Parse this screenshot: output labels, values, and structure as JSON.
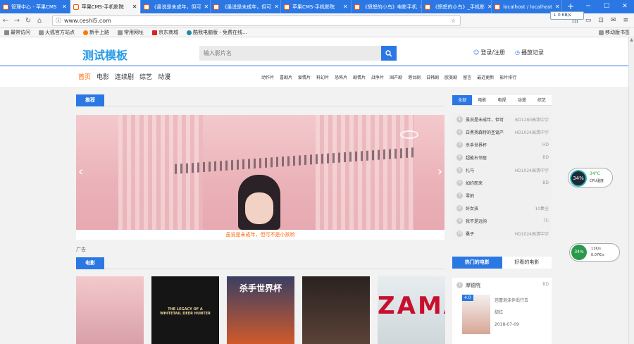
{
  "browser": {
    "tabs": [
      {
        "label": "管理中心 - 苹果CMS",
        "active": false
      },
      {
        "label": "苹果CMS-手机影院",
        "active": true
      },
      {
        "label": "《虽说是未成年，但可",
        "active": false
      },
      {
        "label": "《虽说是未成年，但可",
        "active": false
      },
      {
        "label": "苹果CMS-手机影院",
        "active": false
      },
      {
        "label": "《愤怒的小鸟》电影手机",
        "active": false
      },
      {
        "label": "《愤怒的小鸟》_手机影",
        "active": false
      },
      {
        "label": "localhost / localhost",
        "active": false
      }
    ],
    "url": "www.ceshi5.com",
    "net_badge": "↓ 0 KB/s",
    "bookmarks": [
      "最常访问",
      "火狐官方站点",
      "新手上路",
      "常用网址",
      "京东商城",
      "酷我电脑版 - 免费在线..."
    ],
    "mobile_bookmarks": "移动版书签"
  },
  "site": {
    "logo": "测试模板",
    "search_placeholder": "输入影片名",
    "login": "登录/注册",
    "history": "播放记录",
    "main_nav": [
      "首页",
      "电影",
      "连续剧",
      "综艺",
      "动漫"
    ],
    "cat_nav": [
      "动作片",
      "喜剧片",
      "爱情片",
      "科幻片",
      "恐怖片",
      "剧情片",
      "战争片",
      "国产剧",
      "港台剧",
      "日韩剧",
      "欧美剧",
      "留言",
      "最近更新",
      "影片排行"
    ],
    "recommend_title": "推荐",
    "slide_caption": "虽说是未成年，但可不是小孩哟",
    "ad_label": "广告",
    "movie_section_title": "电影",
    "rank_tabs": [
      "全部",
      "电影",
      "电视",
      "动漫",
      "综艺"
    ],
    "rank_list": [
      {
        "n": "1",
        "title": "虽说是未成年，但可",
        "tag": "BD1280高清中字"
      },
      {
        "n": "2",
        "title": "白黑扬森特的圣诞产",
        "tag": "HD1024高清中字"
      },
      {
        "n": "3",
        "title": "杀手世界杯",
        "tag": "HD"
      },
      {
        "n": "4",
        "title": "超能右邻居",
        "tag": "BD"
      },
      {
        "n": "5",
        "title": "扎马",
        "tag": "HD1024高清中字"
      },
      {
        "n": "6",
        "title": "如约而来",
        "tag": "BD"
      },
      {
        "n": "7",
        "title": "零拍",
        "tag": ""
      },
      {
        "n": "8",
        "title": "好女孩",
        "tag": "10集全"
      },
      {
        "n": "9",
        "title": "我不是远驹",
        "tag": "TC"
      },
      {
        "n": "10",
        "title": "桑子",
        "tag": "HD1024高清中字"
      }
    ],
    "hot_tabs": [
      "热门的电影",
      "好看的电影"
    ],
    "hot_first": {
      "n": "1",
      "title": "摩德院",
      "tag": "BD",
      "score": "4.0",
      "desc": "芭蕾泡沫伴侣行去",
      "extra": "甜红",
      "date": "2018-07-09"
    },
    "posters": [
      {
        "title": ""
      },
      {
        "title": "THE LEGACY OF A WHITETAIL DEER HUNTER"
      },
      {
        "title": "杀手世界杯"
      },
      {
        "title": ""
      },
      {
        "title": "ZAMA"
      }
    ]
  },
  "widgets": {
    "cpu_percent": "34%",
    "cpu_temp": "34°C",
    "cpu_label": "CPU温度",
    "mem_percent": "34%",
    "net_up": "11K/s",
    "net_down": "0.07K/s"
  }
}
